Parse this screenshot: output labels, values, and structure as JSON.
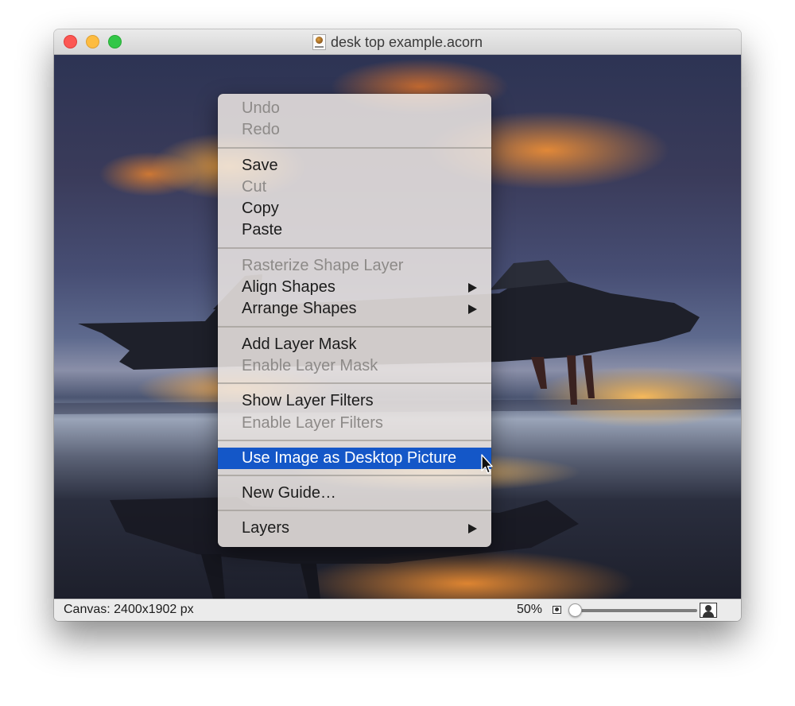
{
  "window": {
    "title": "desk top example.acorn"
  },
  "context_menu": {
    "groups": [
      [
        {
          "label": "Undo",
          "enabled": false
        },
        {
          "label": "Redo",
          "enabled": false
        }
      ],
      [
        {
          "label": "Save",
          "enabled": true
        },
        {
          "label": "Cut",
          "enabled": false
        },
        {
          "label": "Copy",
          "enabled": true
        },
        {
          "label": "Paste",
          "enabled": true
        }
      ],
      [
        {
          "label": "Rasterize Shape Layer",
          "enabled": false
        },
        {
          "label": "Align Shapes",
          "enabled": true,
          "submenu": true
        },
        {
          "label": "Arrange Shapes",
          "enabled": true,
          "submenu": true
        }
      ],
      [
        {
          "label": "Add Layer Mask",
          "enabled": true
        },
        {
          "label": "Enable Layer Mask",
          "enabled": false
        }
      ],
      [
        {
          "label": "Show Layer Filters",
          "enabled": true
        },
        {
          "label": "Enable Layer Filters",
          "enabled": false
        }
      ],
      [
        {
          "label": "Use Image as Desktop Picture",
          "enabled": true,
          "highlighted": true
        }
      ],
      [
        {
          "label": "New Guide…",
          "enabled": true
        }
      ],
      [
        {
          "label": "Layers",
          "enabled": true,
          "submenu": true
        }
      ]
    ]
  },
  "statusbar": {
    "canvas_size": "Canvas: 2400x1902 px",
    "zoom_label": "50%",
    "zoom_slider_fraction": 0.0
  },
  "colors": {
    "highlight": "#1457c8",
    "close": "#fc5753",
    "minimize": "#fdbc40",
    "zoom": "#33c748"
  }
}
